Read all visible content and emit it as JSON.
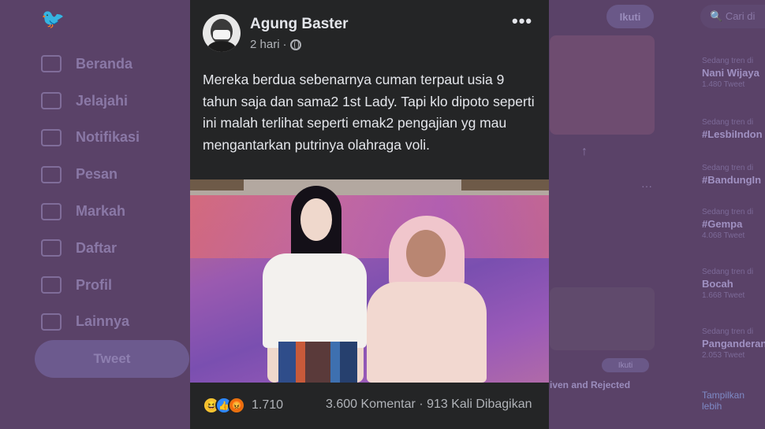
{
  "background": {
    "nav": [
      "Beranda",
      "Jelajahi",
      "Notifikasi",
      "Pesan",
      "Markah",
      "Daftar",
      "Profil",
      "Lainnya"
    ],
    "tweet_button": "Tweet",
    "follow_button": "Ikuti",
    "search_placeholder": "Cari di",
    "trends": [
      {
        "label": "Sedang tren di",
        "title": "Nani Wijaya",
        "count": "1.480 Tweet"
      },
      {
        "label": "Sedang tren di",
        "title": "#LesbiIndon",
        "count": ""
      },
      {
        "label": "Sedang tren di",
        "title": "#BandungIn",
        "count": ""
      },
      {
        "label": "Sedang tren di",
        "title": "#Gempa",
        "count": "4.068 Tweet"
      },
      {
        "label": "Sedang tren di",
        "title": "Bocah",
        "count": "1.668 Tweet"
      },
      {
        "label": "Sedang tren di",
        "title": "Panganderan",
        "count": "2.053 Tweet"
      }
    ],
    "show_more": "Tampilkan lebih",
    "mid_caption": "iven and Rejected",
    "mid_small_button": "Ikuti"
  },
  "post": {
    "author": "Agung Baster",
    "time": "2 hari",
    "separator": "·",
    "more_glyph": "•••",
    "text": "Mereka berdua sebenarnya cuman terpaut usia 9 tahun saja dan sama2 1st Lady. Tapi klo dipoto seperti ini malah terlihat seperti emak2 pengajian yg mau mengantarkan putrinya olahraga voli.",
    "reactions_count": "1.710",
    "comments": "3.600 Komentar",
    "stats_separator": "·",
    "shares": "913 Kali Dibagikan"
  }
}
